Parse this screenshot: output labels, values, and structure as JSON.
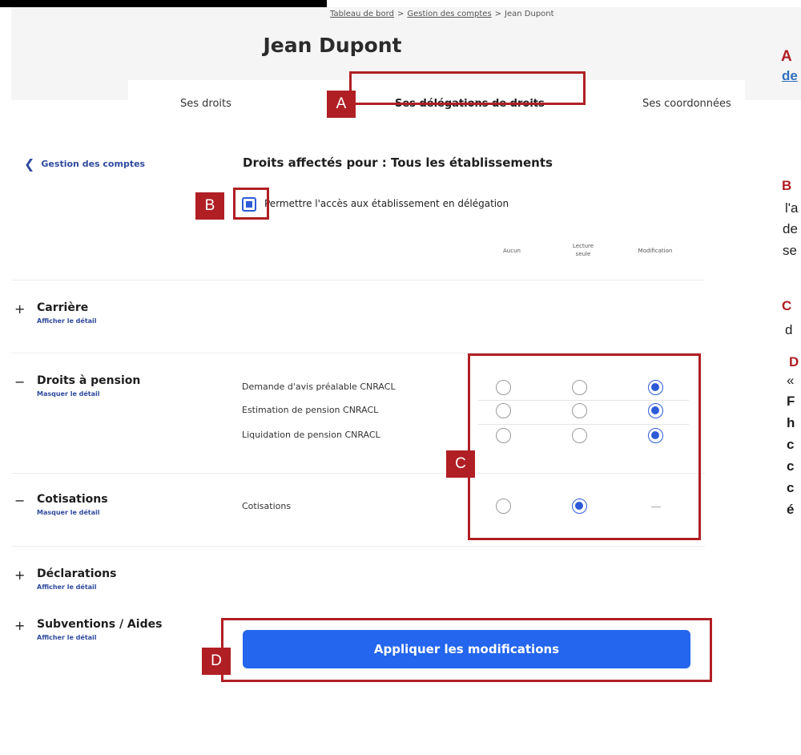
{
  "breadcrumb": {
    "items": [
      "Tableau de bord",
      "Gestion des comptes",
      "Jean Dupont"
    ],
    "separator": ">"
  },
  "page": {
    "title": "Jean Dupont"
  },
  "tabs": [
    {
      "label": "Ses droits",
      "active": false
    },
    {
      "label": "Ses délégations de droits",
      "active": true
    },
    {
      "label": "Ses coordonnées",
      "active": false
    }
  ],
  "back_link": {
    "label": "Gestion des comptes",
    "icon": "chevron-left-icon"
  },
  "section": {
    "title": "Droits affectés pour : Tous les établissements",
    "checkbox_label": "Permettre l'accès aux établissement en délégation",
    "checkbox_checked": true
  },
  "columns": [
    {
      "label": "Aucun"
    },
    {
      "label": "Lecture seule"
    },
    {
      "label": "Modification"
    }
  ],
  "groups": [
    {
      "symbol": "+",
      "title": "Carrière",
      "toggle": "Afficher le détail",
      "rows": []
    },
    {
      "symbol": "−",
      "title": "Droits à pension",
      "toggle": "Masquer le détail",
      "rows": [
        {
          "label": "Demande d'avis préalable CNRACL",
          "selected": "Modification"
        },
        {
          "label": "Estimation de pension CNRACL",
          "selected": "Modification"
        },
        {
          "label": "Liquidation de pension CNRACL",
          "selected": "Modification"
        }
      ]
    },
    {
      "symbol": "−",
      "title": "Cotisations",
      "toggle": "Masquer le détail",
      "rows": [
        {
          "label": "Cotisations",
          "selected": "Lecture seule",
          "modification_available": false
        }
      ]
    },
    {
      "symbol": "+",
      "title": "Déclarations",
      "toggle": "Afficher le détail",
      "rows": []
    },
    {
      "symbol": "+",
      "title": "Subventions / Aides",
      "toggle": "Afficher le détail",
      "rows": []
    }
  ],
  "apply_button": {
    "label": "Appliquer les modifications"
  },
  "annotations": {
    "labels": [
      "A",
      "B",
      "C",
      "D"
    ],
    "color": "#b01f24"
  },
  "side_text": {
    "a_letter": "A",
    "a_fragment": "de",
    "b_letter": "B",
    "b_lines": [
      "l'a",
      "de",
      "se"
    ],
    "c_letter": "C",
    "c_line": "d",
    "d_letter": "D",
    "d_lines": [
      "«",
      "F",
      "h",
      "c",
      "c",
      "c",
      "é"
    ]
  },
  "colors": {
    "accent": "#2466ed",
    "radio_selected": "#2d5bd8",
    "link": "#2f4a9e"
  }
}
